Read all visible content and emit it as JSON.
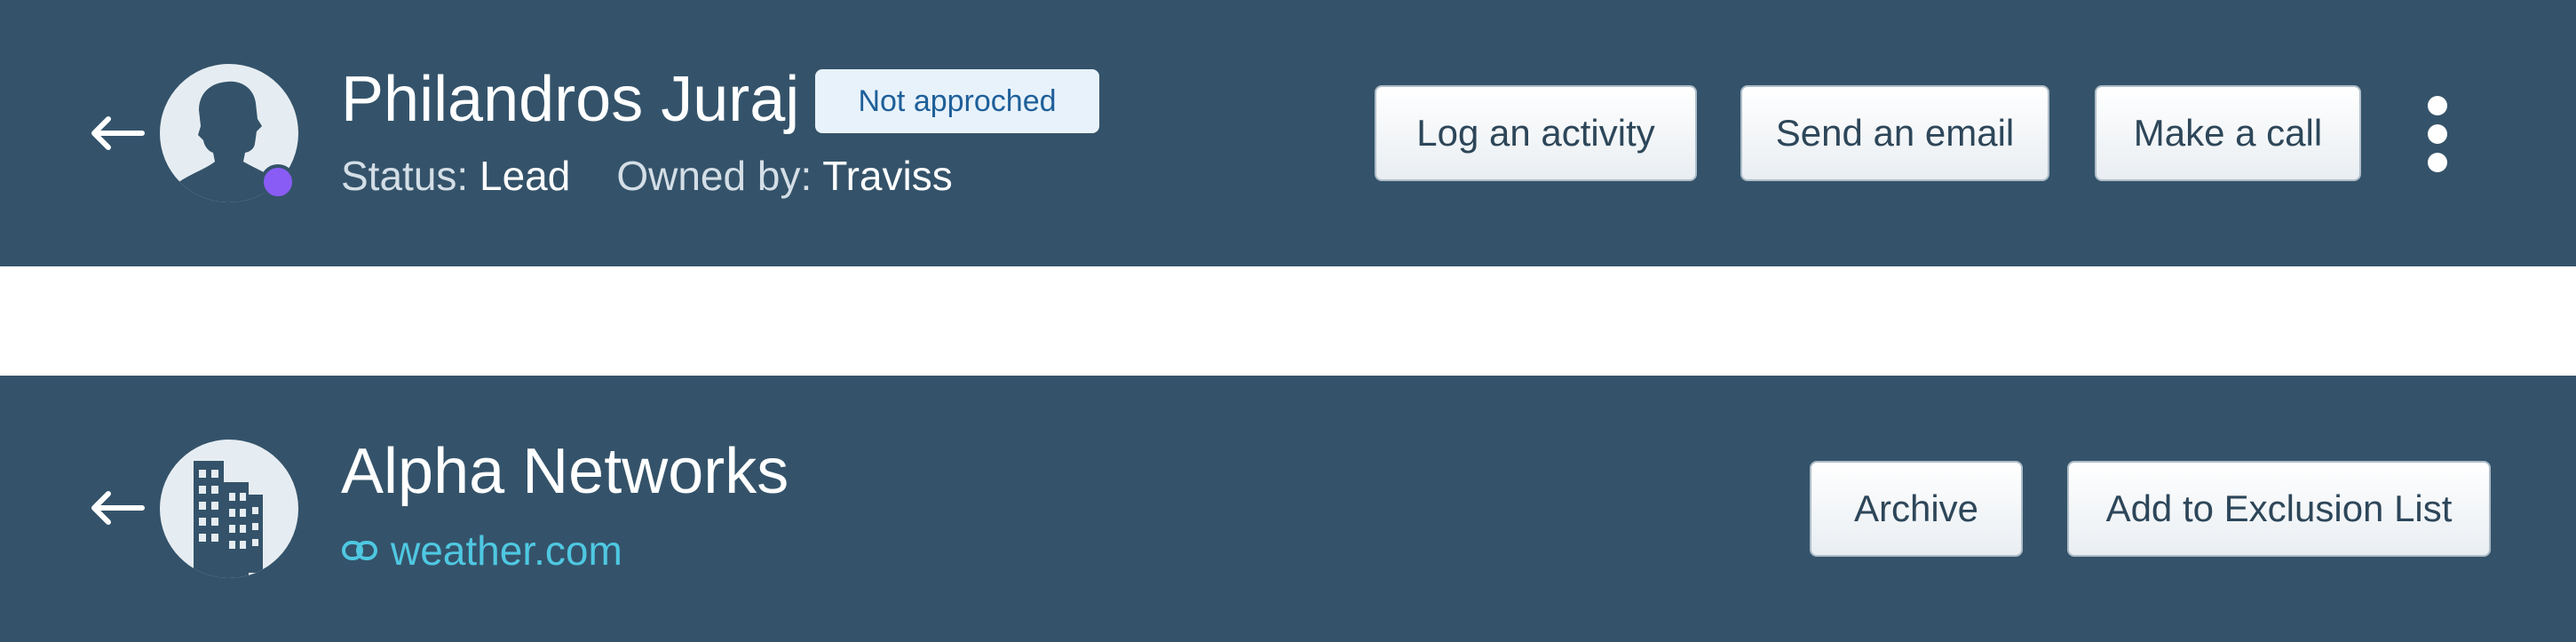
{
  "contact_header": {
    "name": "Philandros Juraj",
    "badge": "Not approched",
    "status_label": "Status:",
    "status_value": "Lead",
    "owner_label": "Owned by:",
    "owner_value": "Traviss",
    "presence_color": "#8a5cf6",
    "actions": {
      "log_activity": "Log an activity",
      "send_email": "Send an email",
      "make_call": "Make a call"
    }
  },
  "company_header": {
    "name": "Alpha Networks",
    "website": "weather.com",
    "actions": {
      "archive": "Archive",
      "add_exclusion": "Add to Exclusion List"
    }
  },
  "icons": {
    "back": "arrow-left-icon",
    "person": "person-silhouette-icon",
    "building": "building-icon",
    "link": "link-icon",
    "more": "more-vertical-icon"
  },
  "colors": {
    "header_bg": "#34536a",
    "link": "#4fc8e2",
    "badge_text": "#1e5f99",
    "badge_bg": "#e8f2fb"
  }
}
